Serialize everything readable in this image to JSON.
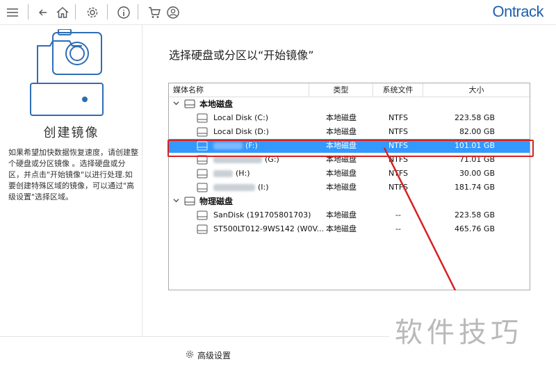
{
  "brand": "Ontrack",
  "toolbar": {
    "icons": [
      "menu-icon",
      "back-icon",
      "home-icon",
      "gear-icon",
      "info-icon",
      "cart-icon",
      "account-icon"
    ]
  },
  "left_panel": {
    "title": "创建镜像",
    "description": "如果希望加快数据恢复速度，请创建整个硬盘或分区镜像 。选择硬盘或分区，并点击\"开始镜像\"以进行处理.如要创建特殊区域的镜像，可以通过\"高级设置\"选择区域。"
  },
  "main": {
    "title": "选择硬盘或分区以“开始镜像”"
  },
  "table": {
    "columns": [
      "媒体名称",
      "类型",
      "系统文件",
      "大小"
    ],
    "groups": [
      {
        "label": "本地磁盘",
        "rows": [
          {
            "name": "Local Disk (C:)",
            "type": "本地磁盘",
            "fs": "NTFS",
            "size": "223.58 GB",
            "selected": false
          },
          {
            "name": "Local Disk (D:)",
            "type": "本地磁盘",
            "fs": "NTFS",
            "size": "82.00 GB",
            "selected": false
          },
          {
            "name": "(F:)",
            "type": "本地磁盘",
            "fs": "NTFS",
            "size": "101.01 GB",
            "selected": true
          },
          {
            "name": "(G:)",
            "type": "本地磁盘",
            "fs": "NTFS",
            "size": "71.01 GB",
            "selected": false
          },
          {
            "name": "(H:)",
            "type": "本地磁盘",
            "fs": "NTFS",
            "size": "30.00 GB",
            "selected": false
          },
          {
            "name": "(I:)",
            "type": "本地磁盘",
            "fs": "NTFS",
            "size": "181.74 GB",
            "selected": false
          }
        ]
      },
      {
        "label": "物理磁盘",
        "rows": [
          {
            "name": "SanDisk (191705801703)",
            "type": "本地磁盘",
            "fs": "--",
            "size": "223.58 GB",
            "selected": false
          },
          {
            "name": "ST500LT012-9WS142 (W0V...",
            "type": "本地磁盘",
            "fs": "--",
            "size": "465.76 GB",
            "selected": false
          }
        ]
      }
    ]
  },
  "advanced_settings_label": "高级设置",
  "watermark": "软件技巧",
  "colors": {
    "brand": "#1f5fae",
    "selection": "#3399ff",
    "annotation": "#d32121",
    "icon_line": "#2d6db5"
  }
}
